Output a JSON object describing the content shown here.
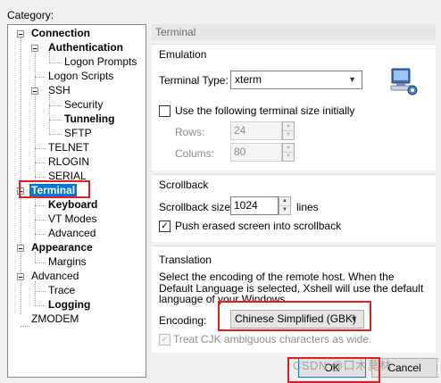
{
  "category_label": "Category:",
  "tree": {
    "connection": "Connection",
    "authentication": "Authentication",
    "logon_prompts": "Logon Prompts",
    "logon_scripts": "Logon Scripts",
    "ssh": "SSH",
    "security": "Security",
    "tunneling": "Tunneling",
    "sftp": "SFTP",
    "telnet": "TELNET",
    "rlogin": "RLOGIN",
    "serial": "SERIAL",
    "terminal": "Terminal",
    "keyboard": "Keyboard",
    "vt_modes": "VT Modes",
    "advanced_term": "Advanced",
    "appearance": "Appearance",
    "margins": "Margins",
    "advanced": "Advanced",
    "trace": "Trace",
    "logging": "Logging",
    "zmodem": "ZMODEM"
  },
  "panel_title": "Terminal",
  "emulation": {
    "title": "Emulation",
    "terminal_type_label": "Terminal Type:",
    "terminal_type_value": "xterm",
    "use_size_label": "Use the following terminal size initially",
    "rows_label": "Rows:",
    "rows_value": "24",
    "columns_label": "Colums:",
    "columns_value": "80"
  },
  "scrollback": {
    "title": "Scrollback",
    "size_label": "Scrollback size:",
    "size_value": "1024",
    "unit": "lines",
    "push_label": "Push erased screen into scrollback"
  },
  "translation": {
    "title": "Translation",
    "description": "Select the encoding of the remote host. When the Default Language is selected, Xshell will use the default language of your Windows.",
    "encoding_label": "Encoding:",
    "encoding_value": "Chinese Simplified (GBK)",
    "cjk_label": "Treat CJK ambiguous characters as wide."
  },
  "buttons": {
    "ok": "OK",
    "cancel": "Cancel"
  },
  "watermark": "CSDN @口木莫林",
  "colors": {
    "highlight_red": "#e02020",
    "selected_blue": "#0078d7"
  }
}
